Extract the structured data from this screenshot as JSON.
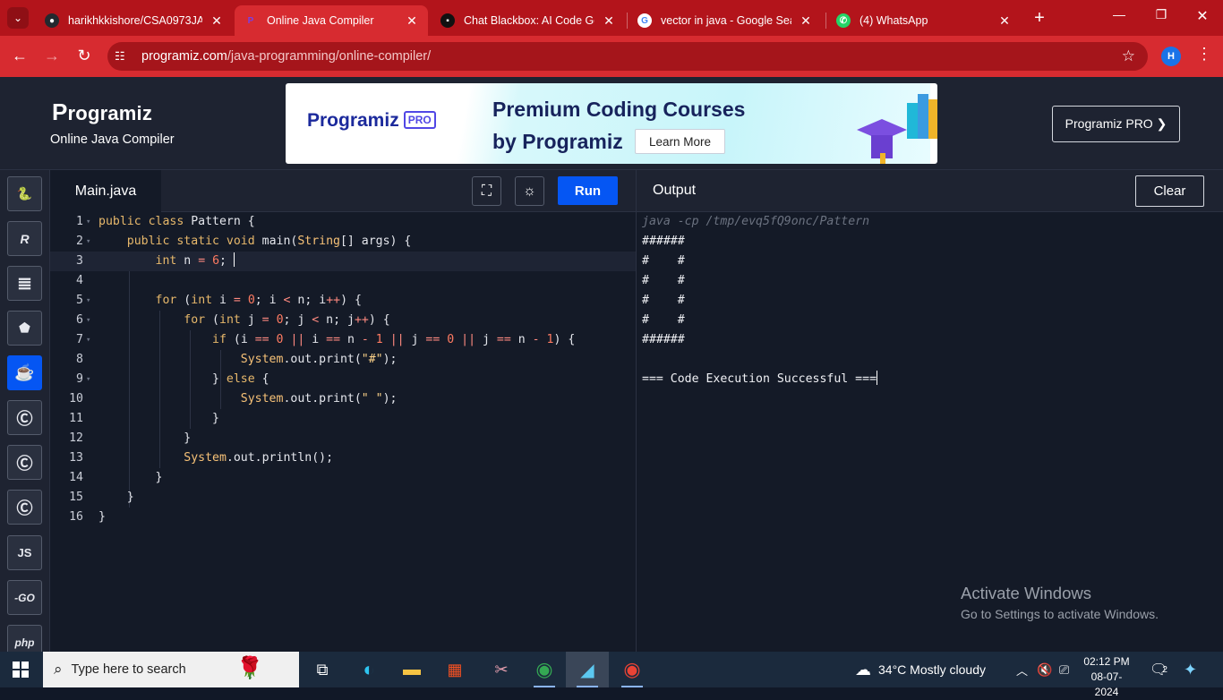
{
  "browser": {
    "tabs": [
      {
        "title": "harikhkkishore/CSA0973JAVA",
        "favicon": "github-icon"
      },
      {
        "title": "Online Java Compiler",
        "favicon": "programiz-icon",
        "active": true
      },
      {
        "title": "Chat Blackbox: AI Code Gene",
        "favicon": "blackbox-icon"
      },
      {
        "title": "vector in java - Google Searc",
        "favicon": "google-icon"
      },
      {
        "title": "(4) WhatsApp",
        "favicon": "whatsapp-icon"
      }
    ],
    "url_host": "programiz.com",
    "url_path": "/java-programming/online-compiler/",
    "profile_initial": "H",
    "accent": "#d72b30"
  },
  "site": {
    "logo_text": "rogramiz",
    "logo_first": "P",
    "subtitle": "Online Java Compiler",
    "pro_button": "Programiz PRO ❯",
    "banner": {
      "logo_text": "Programiz",
      "logo_badge": "PRO",
      "headline_1": "Premium Coding Courses",
      "headline_2": "by Programiz",
      "cta": "Learn More"
    }
  },
  "languages": [
    {
      "icon": "python-icon",
      "glyph": "🐍"
    },
    {
      "icon": "r-icon",
      "glyph": "R"
    },
    {
      "icon": "sql-icon",
      "glyph": "≣"
    },
    {
      "icon": "html5-icon",
      "glyph": "5"
    },
    {
      "icon": "java-icon",
      "glyph": "☕",
      "selected": true
    },
    {
      "icon": "c-icon",
      "glyph": "C"
    },
    {
      "icon": "cpp-icon",
      "glyph": "C"
    },
    {
      "icon": "csharp-icon",
      "glyph": "C"
    },
    {
      "icon": "javascript-icon",
      "glyph": "JS"
    },
    {
      "icon": "go-icon",
      "glyph": "GO"
    },
    {
      "icon": "php-icon",
      "glyph": "php"
    }
  ],
  "editor": {
    "file_tab": "Main.java",
    "run_label": "Run",
    "fullscreen_icon": "fullscreen-icon",
    "theme_icon": "sun-icon",
    "line_numbers": [
      "1",
      "2",
      "3",
      "4",
      "5",
      "6",
      "7",
      "8",
      "9",
      "10",
      "11",
      "12",
      "13",
      "14",
      "15",
      "16"
    ],
    "code_lines": [
      "public class Pattern {",
      "    public static void main(String[] args) {",
      "        int n = 6; ",
      "",
      "        for (int i = 0; i < n; i++) {",
      "            for (int j = 0; j < n; j++) {",
      "                if (i == 0 || i == n - 1 || j == 0 || j == n - 1) {",
      "                    System.out.print(\"#\");",
      "                } else {",
      "                    System.out.print(\" \");",
      "                }",
      "            }",
      "            System.out.println();",
      "        }",
      "    }",
      "}"
    ]
  },
  "output": {
    "label": "Output",
    "clear_label": "Clear",
    "command": "java -cp /tmp/evq5fQ9onc/Pattern",
    "lines": [
      "######",
      "#    #",
      "#    #",
      "#    #",
      "#    #",
      "######",
      "",
      "=== Code Execution Successful ==="
    ]
  },
  "watermark": {
    "line1": "Activate Windows",
    "line2": "Go to Settings to activate Windows."
  },
  "taskbar": {
    "search_placeholder": "Type here to search",
    "weather": "34°C  Mostly cloudy",
    "time": "02:12 PM",
    "date": "08-07-2024",
    "notifications": "2"
  }
}
